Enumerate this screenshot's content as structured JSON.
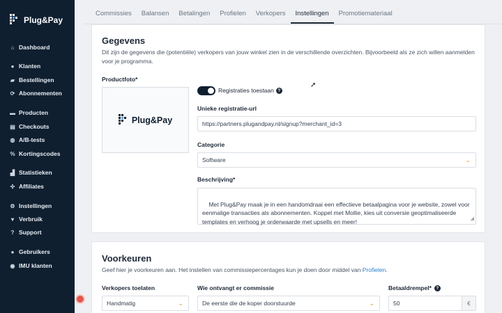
{
  "brand": {
    "name": "Plug&Pay"
  },
  "sidebar": {
    "items": [
      {
        "label": "Dashboard",
        "icon": "home-icon",
        "glyph": "⌂"
      },
      {
        "label": "Klanten",
        "icon": "users-icon",
        "glyph": "●"
      },
      {
        "label": "Bestellingen",
        "icon": "cart-icon",
        "glyph": "▰"
      },
      {
        "label": "Abonnementen",
        "icon": "refresh-icon",
        "glyph": "⟳"
      },
      {
        "label": "Producten",
        "icon": "box-icon",
        "glyph": "▬"
      },
      {
        "label": "Checkouts",
        "icon": "checkout-icon",
        "glyph": "▤"
      },
      {
        "label": "A/B-tests",
        "icon": "flask-icon",
        "glyph": "◍"
      },
      {
        "label": "Kortingscodes",
        "icon": "percent-icon",
        "glyph": "%"
      },
      {
        "label": "Statistieken",
        "icon": "chart-icon",
        "glyph": "▟"
      },
      {
        "label": "Affiliates",
        "icon": "share-icon",
        "glyph": "✣"
      },
      {
        "label": "Instellingen",
        "icon": "gear-icon",
        "glyph": "⚙"
      },
      {
        "label": "Verbruik",
        "icon": "cloud-icon",
        "glyph": "▾"
      },
      {
        "label": "Support",
        "icon": "question-icon",
        "glyph": "?"
      },
      {
        "label": "Gebruikers",
        "icon": "team-icon",
        "glyph": "●"
      },
      {
        "label": "IMU klanten",
        "icon": "globe-icon",
        "glyph": "◉"
      }
    ]
  },
  "tabs": [
    {
      "label": "Commissies",
      "active": false
    },
    {
      "label": "Balansen",
      "active": false
    },
    {
      "label": "Betalingen",
      "active": false
    },
    {
      "label": "Profielen",
      "active": false
    },
    {
      "label": "Verkopers",
      "active": false
    },
    {
      "label": "Instellingen",
      "active": true
    },
    {
      "label": "Promotiemateriaal",
      "active": false
    }
  ],
  "gegevens": {
    "title": "Gegevens",
    "description": "Dit zijn de gegevens die (potentiële) verkopers van jouw winkel zien in de verschillende overzichten. Bijvoorbeeld als ze zich willen aanmelden voor je programma.",
    "photo_label": "Productfoto*",
    "toggle_label": "Registraties toestaan",
    "toggle_on": true,
    "help_glyph": "?",
    "url_label": "Unieke registratie-url",
    "url_value": "https://partners.plugandpay.nl/signup?merchant_id=3",
    "category_label": "Categorie",
    "category_value": "Software",
    "description_label": "Beschrijving*",
    "description_value": "Met Plug&Pay maak je in een handomdraai een effectieve betaalpagina voor je website, zowel voor eenmalige transacties als abonnementen. Koppel met Mollie, kies uit conversie geoptimaliseerde templates en verhoog je orderwaarde met upsells en meer!"
  },
  "voorkeuren": {
    "title": "Voorkeuren",
    "description_prefix": "Geef hier je voorkeuren aan. Het instellen van commissiepercentages kun je doen door middel van ",
    "description_link": "Profielen",
    "description_suffix": ".",
    "sellers_label": "Verkopers toelaten",
    "sellers_value": "Handmatig",
    "commission_label": "Wie ontvangt er commissie",
    "commission_value": "De eerste die de koper doorstuurde",
    "threshold_label": "Betaaldrempel*",
    "threshold_value": "50",
    "currency_symbol": "€"
  },
  "colors": {
    "sidebar": "#0f1f30",
    "accent": "#e3962c",
    "link": "#2a7fc9",
    "notification": "#e2574c"
  }
}
